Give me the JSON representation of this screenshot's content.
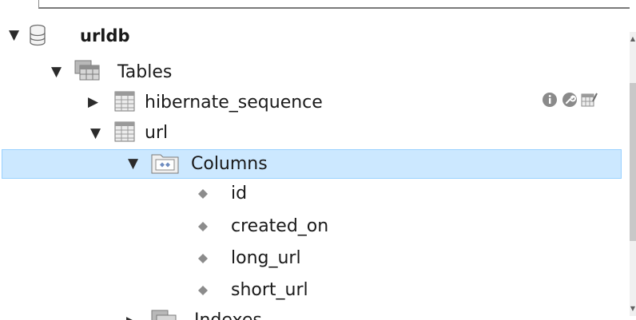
{
  "tree": {
    "database": {
      "label": "urldb",
      "expanded": true
    },
    "tables_folder": {
      "label": "Tables",
      "expanded": true
    },
    "tables": [
      {
        "label": "hibernate_sequence",
        "expanded": false
      },
      {
        "label": "url",
        "expanded": true
      }
    ],
    "columns_folder": {
      "label": "Columns",
      "expanded": true,
      "selected": true
    },
    "columns": [
      "id",
      "created_on",
      "long_url",
      "short_url"
    ],
    "next_folder_label": "Indexes"
  },
  "row_actions": [
    "info-icon",
    "wrench-icon",
    "table-data-icon"
  ],
  "colors": {
    "selection_bg": "#cce8ff",
    "selection_border": "#99d1ff",
    "column_diamond": "#8c8c8c"
  }
}
